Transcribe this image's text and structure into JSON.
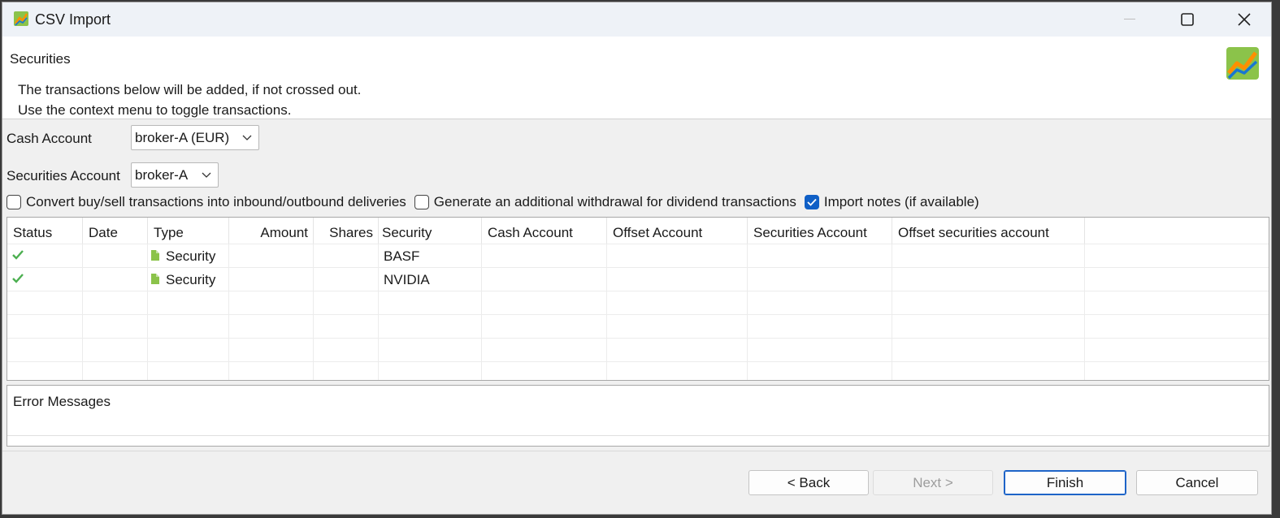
{
  "window": {
    "title": "CSV Import"
  },
  "header": {
    "title": "Securities",
    "line1": "The transactions below will be added, if not crossed out.",
    "line2": "Use the context menu to toggle transactions."
  },
  "form": {
    "cash_account_label": "Cash Account",
    "cash_account_value": "broker-A (EUR)",
    "securities_account_label": "Securities Account",
    "securities_account_value": "broker-A"
  },
  "options": [
    {
      "label": "Convert buy/sell transactions into inbound/outbound deliveries",
      "checked": false
    },
    {
      "label": "Generate an additional withdrawal for dividend transactions",
      "checked": false
    },
    {
      "label": "Import notes (if available)",
      "checked": true
    }
  ],
  "table": {
    "columns": [
      "Status",
      "Date",
      "Type",
      "Amount",
      "Shares",
      "Security",
      "Cash Account",
      "Offset Account",
      "Securities Account",
      "Offset securities account"
    ],
    "rows": [
      {
        "status": "ok",
        "date": "",
        "type": "Security",
        "amount": "",
        "shares": "",
        "security": "BASF",
        "cash_account": "",
        "offset_account": "",
        "securities_account": "",
        "offset_securities_account": ""
      },
      {
        "status": "ok",
        "date": "",
        "type": "Security",
        "amount": "",
        "shares": "",
        "security": "NVIDIA",
        "cash_account": "",
        "offset_account": "",
        "securities_account": "",
        "offset_securities_account": ""
      }
    ]
  },
  "errors": {
    "title": "Error Messages"
  },
  "buttons": {
    "back": "< Back",
    "next": "Next >",
    "finish": "Finish",
    "cancel": "Cancel"
  },
  "colors": {
    "accent": "#0f5fc6",
    "ok_check": "#4caf50",
    "doc_icon": "#8bc34a"
  },
  "icons": {
    "status_ok": "checkmark-icon",
    "type_security": "document-icon"
  }
}
